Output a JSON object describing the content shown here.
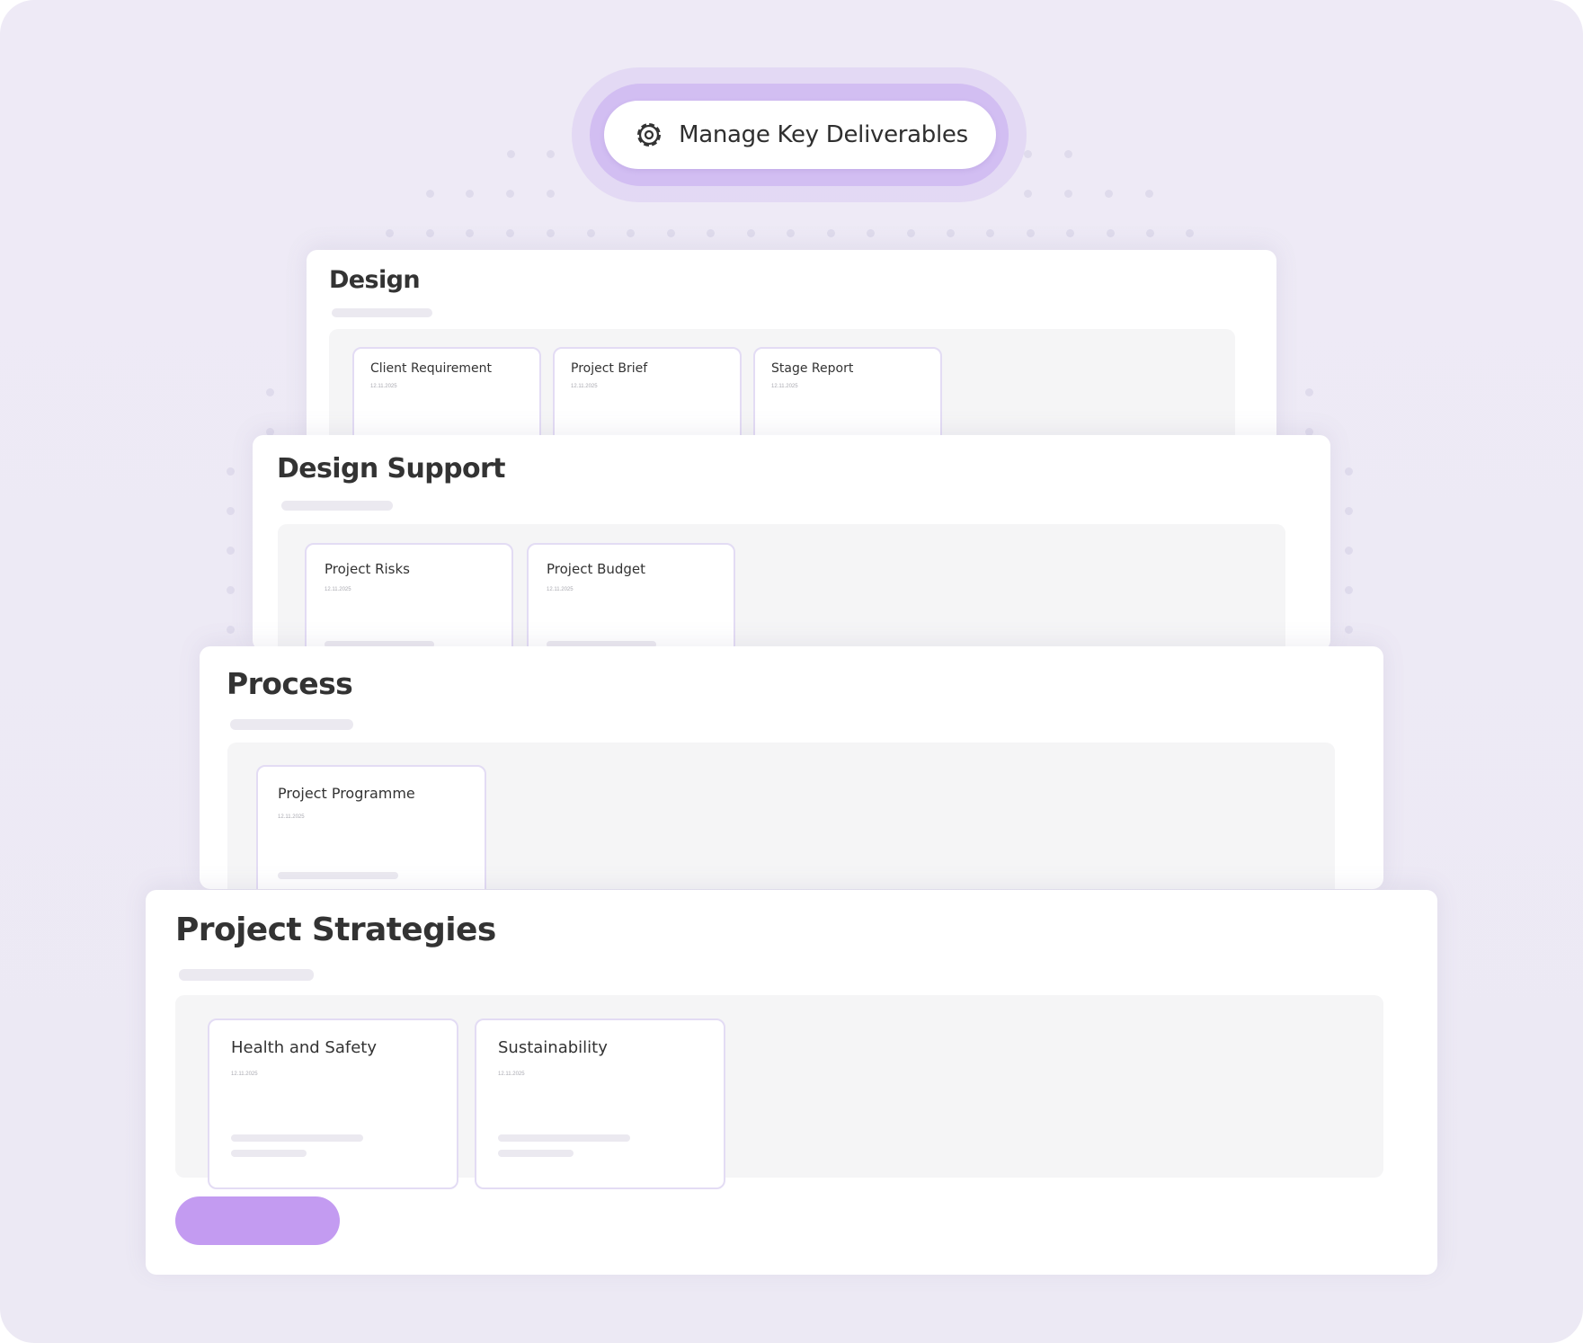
{
  "header": {
    "label": "Manage Key Deliverables",
    "icon": "gear-icon"
  },
  "sections": [
    {
      "title": "Design",
      "cards": [
        {
          "title": "Client Requirement",
          "date": "12.11.2025"
        },
        {
          "title": "Project Brief",
          "date": "12.11.2025"
        },
        {
          "title": "Stage Report",
          "date": "12.11.2025"
        }
      ]
    },
    {
      "title": "Design Support",
      "cards": [
        {
          "title": "Project Risks",
          "date": "12.11.2025"
        },
        {
          "title": "Project Budget",
          "date": "12.11.2025"
        }
      ]
    },
    {
      "title": "Process",
      "cards": [
        {
          "title": "Project Programme",
          "date": "12.11.2025"
        }
      ]
    },
    {
      "title": "Project Strategies",
      "cards": [
        {
          "title": "Health and Safety",
          "date": "12.11.2025"
        },
        {
          "title": "Sustainability",
          "date": "12.11.2025"
        }
      ]
    }
  ],
  "colors": {
    "accent": "#c39bf1",
    "background": "#eeeaf6",
    "card_border": "#e3dcf4",
    "text": "#333333"
  }
}
